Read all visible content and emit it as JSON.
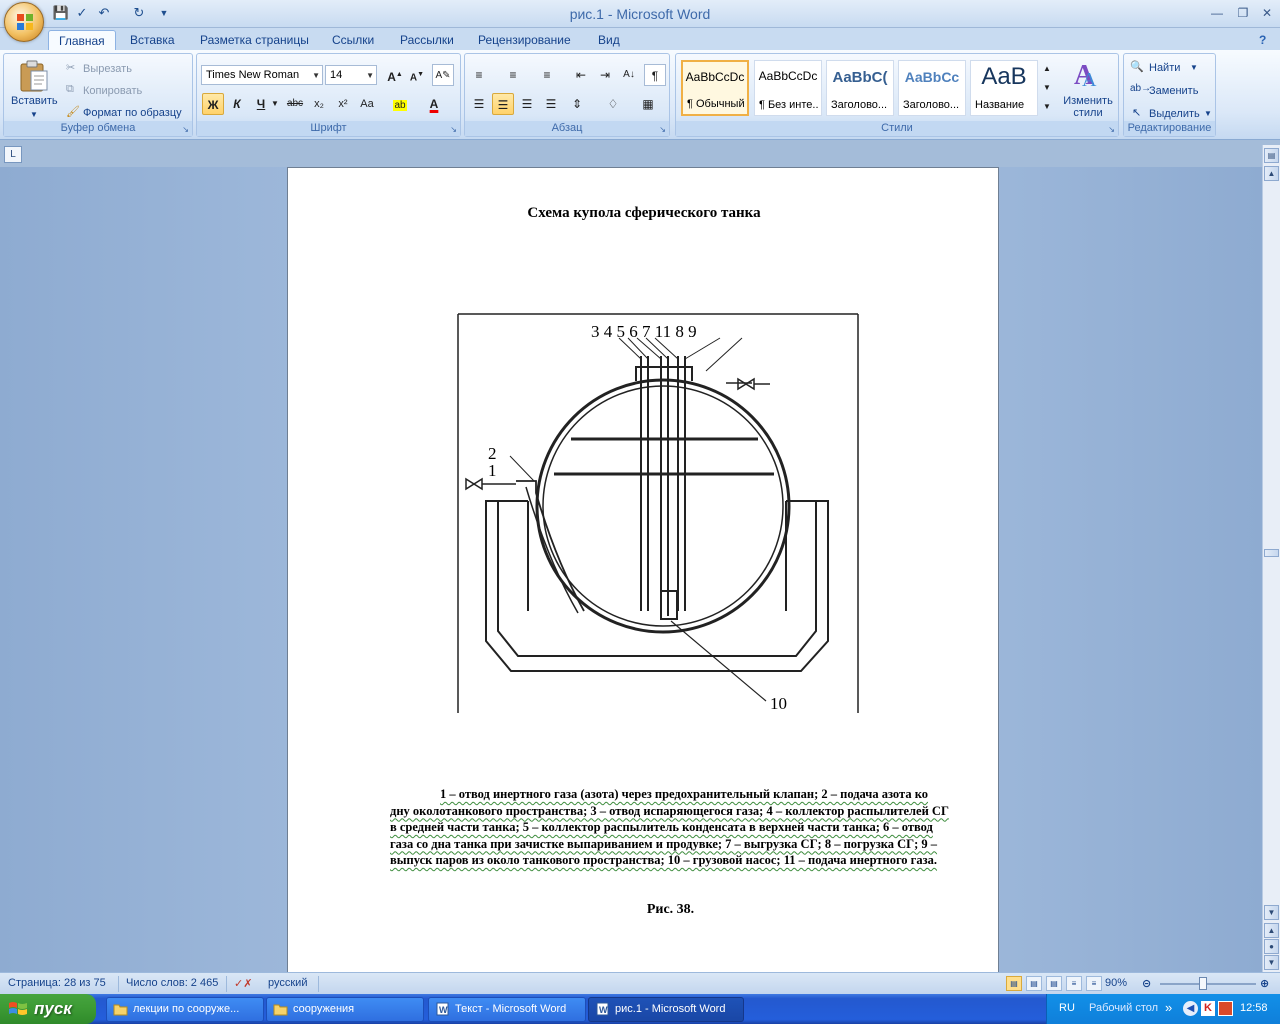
{
  "window": {
    "title": "рис.1 - Microsoft Word"
  },
  "tabs": [
    "Главная",
    "Вставка",
    "Разметка страницы",
    "Ссылки",
    "Рассылки",
    "Рецензирование",
    "Вид"
  ],
  "clipboard": {
    "paste": "Вставить",
    "cut": "Вырезать",
    "copy": "Копировать",
    "format_painter": "Формат по образцу",
    "label": "Буфер обмена"
  },
  "font": {
    "name": "Times New Roman",
    "size": "14",
    "label": "Шрифт",
    "buttons": {
      "bold": "Ж",
      "italic": "К",
      "underline": "Ч",
      "strike": "abc",
      "subscript": "x₂",
      "superscript": "x²",
      "case": "Aa"
    }
  },
  "paragraph": {
    "label": "Абзац"
  },
  "styles": {
    "label": "Стили",
    "change_styles": "Изменить стили",
    "items": [
      {
        "sample": "AaBbCcDc",
        "name": "¶ Обычный"
      },
      {
        "sample": "AaBbCcDc",
        "name": "¶ Без инте..."
      },
      {
        "sample": "AaBbC(",
        "name": "Заголово..."
      },
      {
        "sample": "AaBbCc",
        "name": "Заголово..."
      },
      {
        "sample": "AaB",
        "name": "Название"
      }
    ]
  },
  "editing": {
    "label": "Редактирование",
    "find": "Найти",
    "replace": "Заменить",
    "select": "Выделить"
  },
  "document": {
    "title": "Схема купола сферического танка",
    "figure_labels": {
      "top": "3 4 5 6 7  11 8   9",
      "l1": "1",
      "l2": "2",
      "l10": "10"
    },
    "caption": "1 – отвод инертного газа (азота) через предохранительный клапан; 2 – подача азота ко дну околотанкового пространства; 3 – отвод испаряющегося газа; 4 – коллектор распылителей СГ в средней части танка; 5 – коллектор распылитель конденсата в верхней части танка; 6 – отвод газа со дна танка при зачистке выпариванием и продувке; 7 – выгрузка СГ; 8 – погрузка СГ; 9 – выпуск паров из около танкового пространства; 10 – грузовой насос; 11 – подача инертного газа.",
    "figure_number": "Рис. 38."
  },
  "status": {
    "page": "Страница: 28 из 75",
    "words": "Число слов: 2 465",
    "language": "русский",
    "zoom": "90%",
    "zoom_level": 0.45
  },
  "taskbar": {
    "start": "пуск",
    "items": [
      {
        "label": "лекции по сооруже..."
      },
      {
        "label": "сооружения"
      },
      {
        "label": "Текст - Microsoft Word"
      },
      {
        "label": "рис.1 - Microsoft Word"
      }
    ],
    "lang": "RU",
    "desktop": "Рабочий стол",
    "clock": "12:58"
  },
  "colors": {
    "accent": "#15428b",
    "ribbon": "#dbe8f8",
    "taskbar": "#245edb",
    "start": "#3c9a34"
  }
}
